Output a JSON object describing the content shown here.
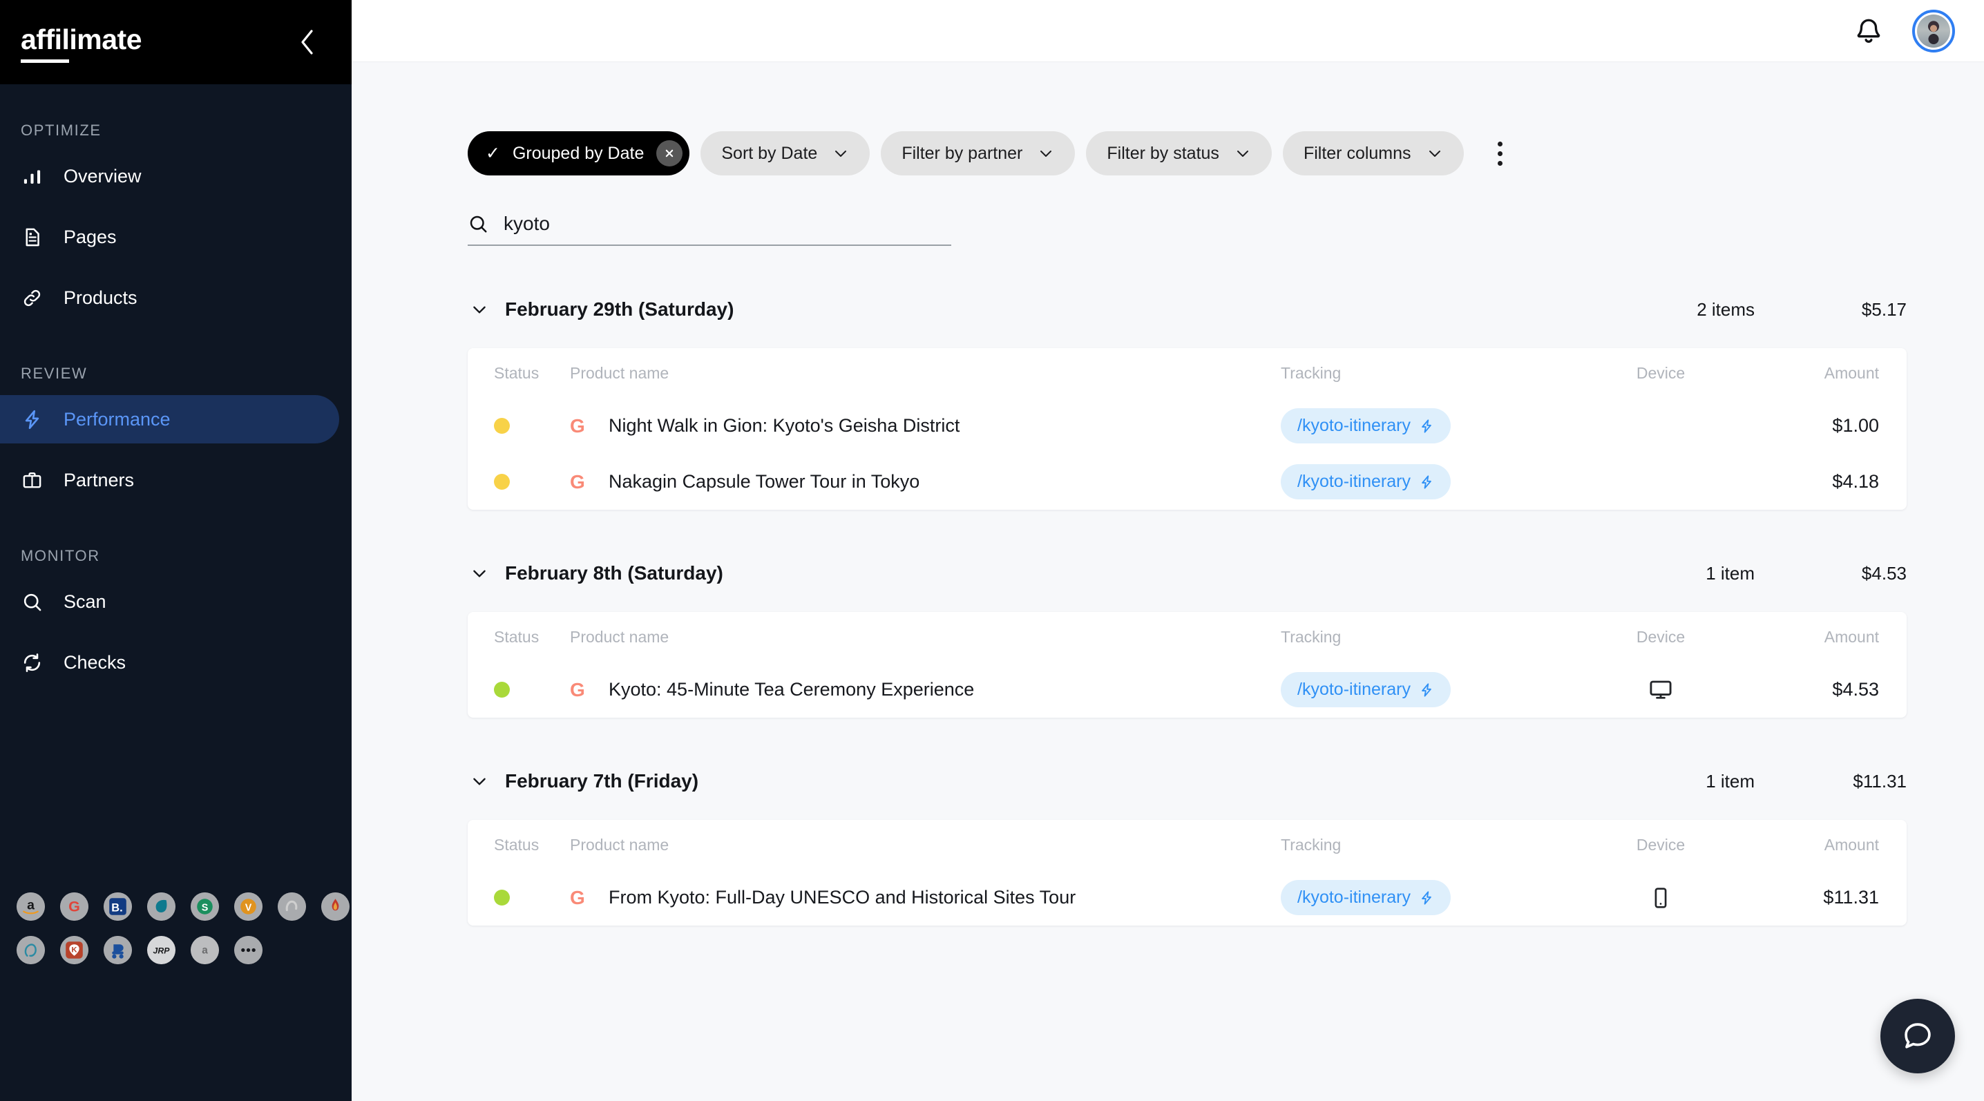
{
  "brand": {
    "name_underlined": "affil",
    "name_rest": "imate"
  },
  "sidebar": {
    "sections": [
      {
        "label": "OPTIMIZE",
        "items": [
          {
            "label": "Overview",
            "icon": "bar-chart-icon",
            "active": false
          },
          {
            "label": "Pages",
            "icon": "document-icon",
            "active": false
          },
          {
            "label": "Products",
            "icon": "link-icon",
            "active": false
          }
        ]
      },
      {
        "label": "REVIEW",
        "items": [
          {
            "label": "Performance",
            "icon": "lightning-icon",
            "active": true
          },
          {
            "label": "Partners",
            "icon": "briefcase-icon",
            "active": false
          }
        ]
      },
      {
        "label": "MONITOR",
        "items": [
          {
            "label": "Scan",
            "icon": "search-icon",
            "active": false
          },
          {
            "label": "Checks",
            "icon": "refresh-icon",
            "active": false
          }
        ]
      }
    ],
    "partners": [
      {
        "name": "amazon",
        "glyph": "a"
      },
      {
        "name": "getyourguide",
        "glyph": "G"
      },
      {
        "name": "booking-com",
        "glyph": "B."
      },
      {
        "name": "skyscanner",
        "glyph": ""
      },
      {
        "name": "stay22",
        "glyph": "S"
      },
      {
        "name": "viator",
        "glyph": "V"
      },
      {
        "name": "omio",
        "glyph": ""
      },
      {
        "name": "firefly",
        "glyph": ""
      },
      {
        "name": "nomad",
        "glyph": ""
      },
      {
        "name": "klook",
        "glyph": "K"
      },
      {
        "name": "discover-cars",
        "glyph": ""
      },
      {
        "name": "jrpass",
        "glyph": "JRP"
      },
      {
        "name": "amazon-associates",
        "glyph": "a"
      },
      {
        "name": "more-partners",
        "glyph": "•••"
      }
    ]
  },
  "topbar": {
    "bell": "notifications-bell-icon",
    "avatar": "user-avatar"
  },
  "toolbar": {
    "grouped_chip": {
      "label": "Grouped by Date",
      "check": "✓",
      "clear": "✕"
    },
    "chips": [
      {
        "label": "Sort by Date"
      },
      {
        "label": "Filter by partner"
      },
      {
        "label": "Filter by status"
      },
      {
        "label": "Filter columns"
      }
    ],
    "more_label": "more-options"
  },
  "search": {
    "value": "kyoto",
    "placeholder": "Search"
  },
  "table": {
    "columns": [
      "Status",
      "Product name",
      "Tracking",
      "Device",
      "Amount"
    ]
  },
  "groups": [
    {
      "date": "February 29th (Saturday)",
      "count": "2 items",
      "amount": "$5.17",
      "rows": [
        {
          "status_color": "#f8d248",
          "partner": "G",
          "name": "Night Walk in Gion: Kyoto's Geisha District",
          "tracking": "/kyoto-itinerary",
          "device": "",
          "amount": "$1.00"
        },
        {
          "status_color": "#f8d248",
          "partner": "G",
          "name": "Nakagin Capsule Tower Tour in Tokyo",
          "tracking": "/kyoto-itinerary",
          "device": "",
          "amount": "$4.18"
        }
      ]
    },
    {
      "date": "February 8th (Saturday)",
      "count": "1 item",
      "amount": "$4.53",
      "rows": [
        {
          "status_color": "#a9d93a",
          "partner": "G",
          "name": "Kyoto: 45-Minute Tea Ceremony Experience",
          "tracking": "/kyoto-itinerary",
          "device": "desktop",
          "amount": "$4.53"
        }
      ]
    },
    {
      "date": "February 7th (Friday)",
      "count": "1 item",
      "amount": "$11.31",
      "rows": [
        {
          "status_color": "#a9d93a",
          "partner": "G",
          "name": "From Kyoto: Full-Day UNESCO and Historical Sites Tour",
          "tracking": "/kyoto-itinerary",
          "device": "mobile",
          "amount": "$11.31"
        }
      ]
    }
  ],
  "chat": {
    "label": "help-chat"
  },
  "colors": {
    "sidebar_bg": "#0e1623",
    "brandbar_bg": "#000000",
    "active_nav_bg": "#1a315c",
    "active_nav_fg": "#5b96f7",
    "pill_bg": "#deeffc",
    "pill_fg": "#2f90f5",
    "status_pending": "#f8d248",
    "status_confirmed": "#a9d93a",
    "partner_mark": "#f98a77"
  }
}
